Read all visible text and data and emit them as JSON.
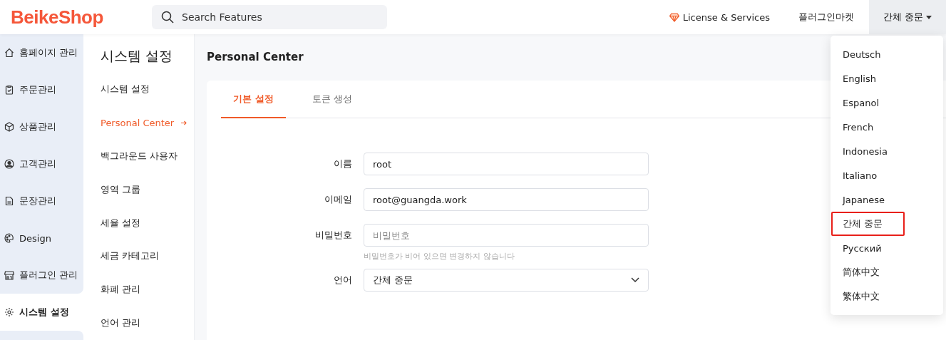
{
  "header": {
    "logo": "BeikeShop",
    "search": {
      "placeholder": "Search Features"
    },
    "license_link": "License & Services",
    "plugin_market": "플러그인마켓",
    "language_menu": {
      "label": "간체 중문",
      "expanded": true
    }
  },
  "sidebar": {
    "items": [
      {
        "label": "홈페이지 관리",
        "selected": false
      },
      {
        "label": "주문관리",
        "selected": false
      },
      {
        "label": "상품관리",
        "selected": false
      },
      {
        "label": "고객관리",
        "selected": false
      },
      {
        "label": "문장관리",
        "selected": false
      },
      {
        "label": "Design",
        "selected": false
      },
      {
        "label": "플러그인 관리",
        "selected": false
      },
      {
        "label": "시스템 설정",
        "selected": true
      }
    ]
  },
  "subnav": {
    "title": "시스템 설정",
    "items": [
      {
        "label": "시스템 설정",
        "selected": false
      },
      {
        "label": "Personal Center",
        "selected": true
      },
      {
        "label": "백그라운드 사용자",
        "selected": false
      },
      {
        "label": "영역 그룹",
        "selected": false
      },
      {
        "label": "세율 설정",
        "selected": false
      },
      {
        "label": "세금 카테고리",
        "selected": false
      },
      {
        "label": "화폐 관리",
        "selected": false
      },
      {
        "label": "언어 관리",
        "selected": false
      }
    ]
  },
  "page": {
    "title": "Personal Center",
    "tabs": [
      {
        "label": "기본 설정",
        "selected": true
      },
      {
        "label": "토큰 생성",
        "selected": false
      }
    ],
    "fields": [
      {
        "kind": "text",
        "label": "이름",
        "value": "root"
      },
      {
        "kind": "text",
        "label": "이메일",
        "value": "root@guangda.work"
      },
      {
        "kind": "password",
        "label": "비밀번호",
        "placeholder": "비밀번호",
        "hint": "비밀번호가 비어 있으면 변경하지 않습니다"
      },
      {
        "kind": "select",
        "label": "언어",
        "value": "간체 중문"
      }
    ]
  },
  "language_dropdown": {
    "items": [
      {
        "label": "Deutsch",
        "selected": false
      },
      {
        "label": "English",
        "selected": false
      },
      {
        "label": "Espanol",
        "selected": false
      },
      {
        "label": "French",
        "selected": false
      },
      {
        "label": "Indonesia",
        "selected": false
      },
      {
        "label": "Italiano",
        "selected": false
      },
      {
        "label": "Japanese",
        "selected": false
      },
      {
        "label": "간체 중문",
        "selected": true
      },
      {
        "label": "Русский",
        "selected": false
      },
      {
        "label": "简体中文",
        "selected": false
      },
      {
        "label": "繁体中文",
        "selected": false
      }
    ]
  }
}
